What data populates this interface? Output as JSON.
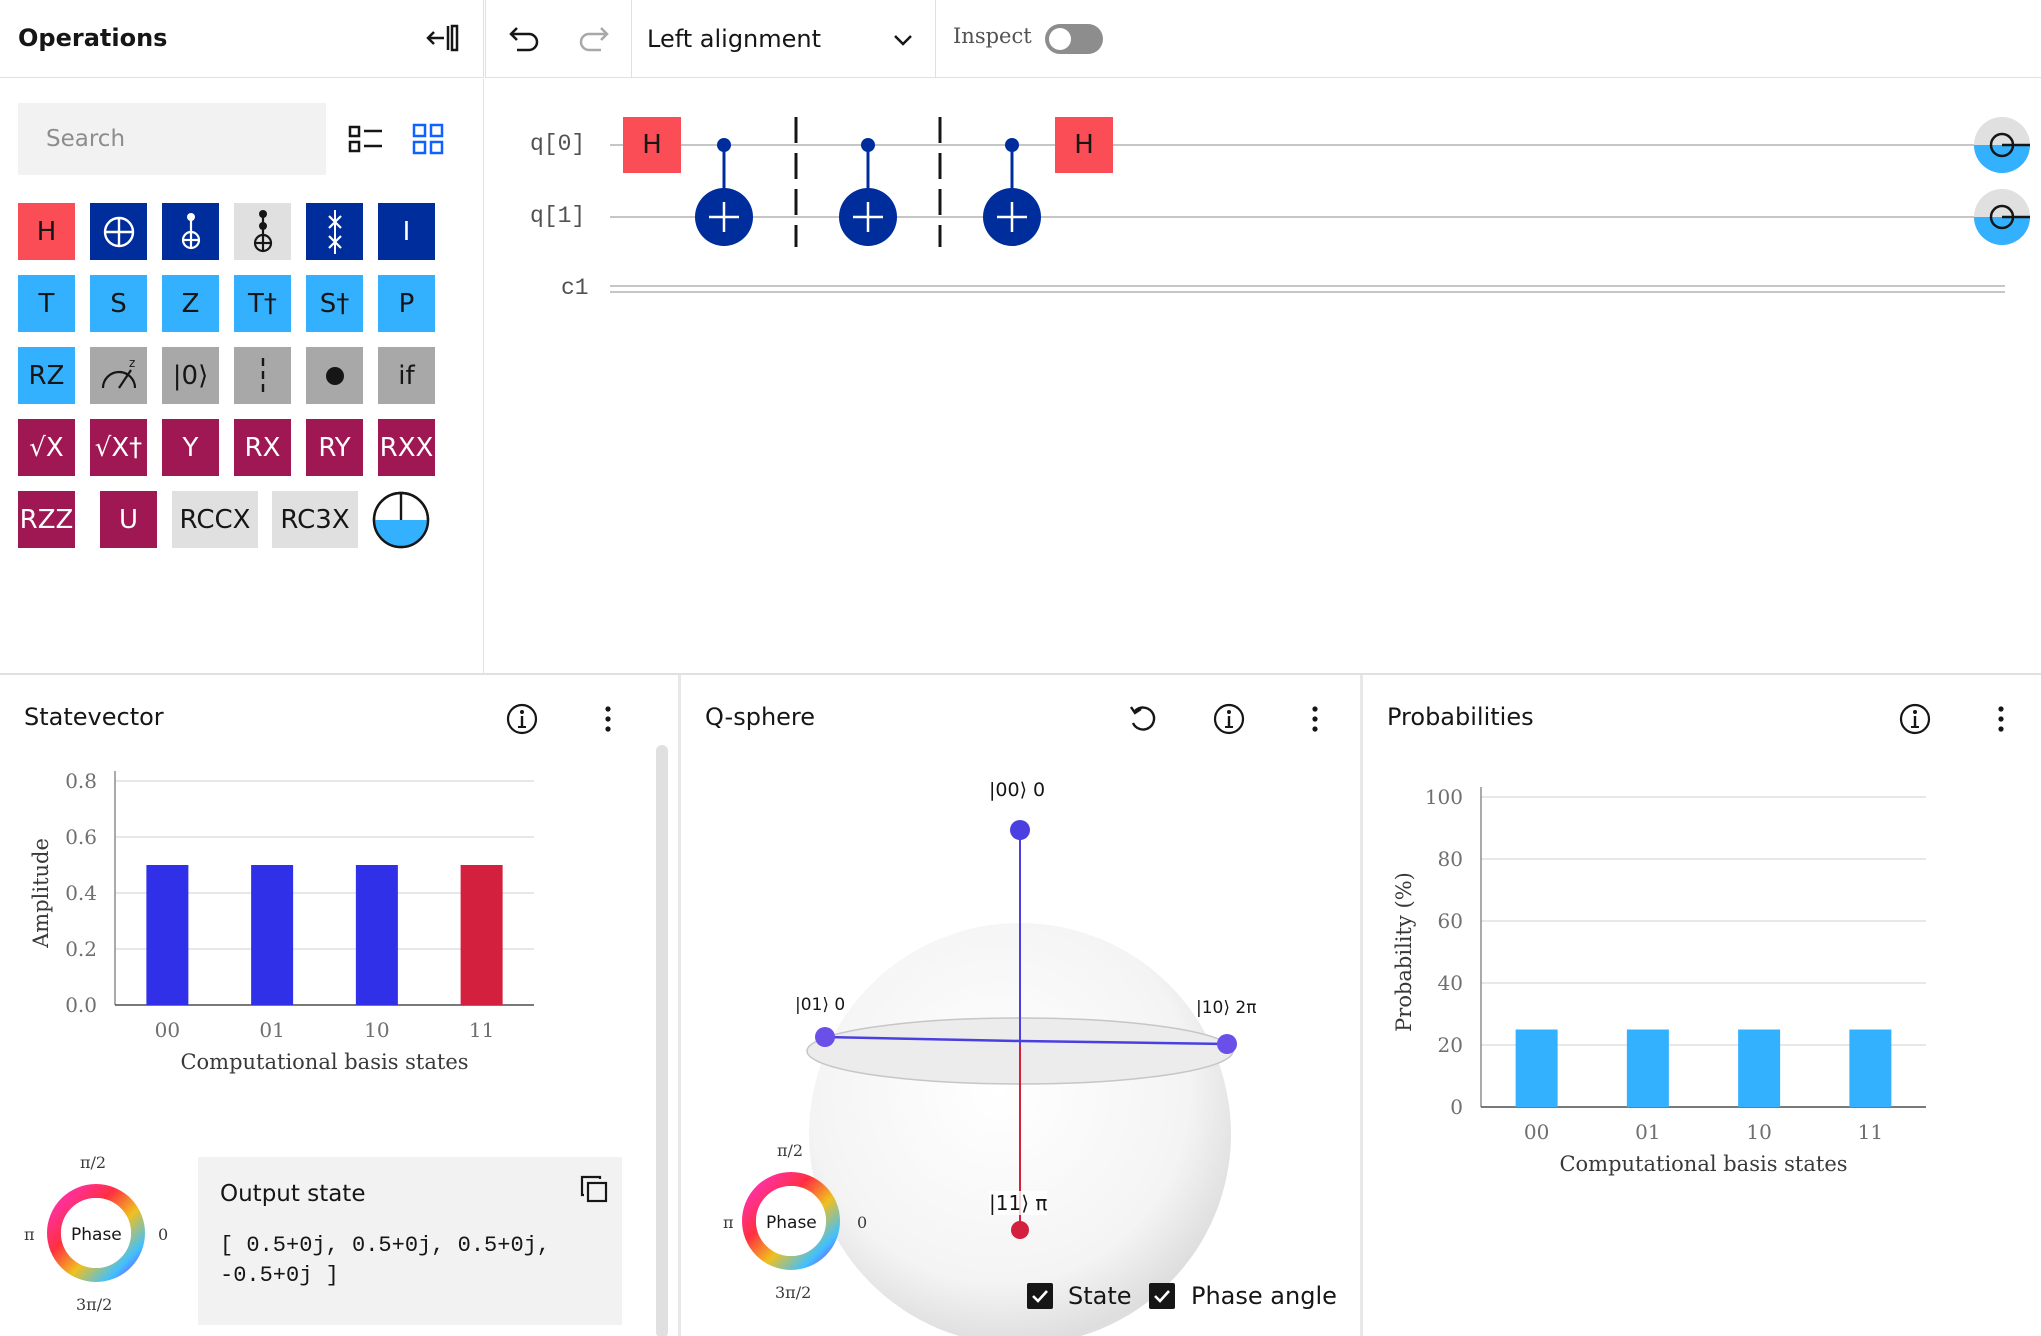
{
  "operations": {
    "title": "Operations",
    "search_placeholder": "Search",
    "gates": [
      {
        "label": "H",
        "bg": "#fa4d56",
        "fg": "#161616"
      },
      {
        "label": "",
        "bg": "#002d9c",
        "fg": "#ffffff",
        "icon": "cnot-target-icon"
      },
      {
        "label": "",
        "bg": "#002d9c",
        "fg": "#ffffff",
        "icon": "controlled-x-icon"
      },
      {
        "label": "",
        "bg": "#e0e0e0",
        "fg": "#161616",
        "icon": "toffoli-icon"
      },
      {
        "label": "",
        "bg": "#002d9c",
        "fg": "#ffffff",
        "icon": "swap-icon"
      },
      {
        "label": "I",
        "bg": "#002d9c",
        "fg": "#ffffff"
      },
      {
        "label": "T",
        "bg": "#33b1ff",
        "fg": "#161616"
      },
      {
        "label": "S",
        "bg": "#33b1ff",
        "fg": "#161616"
      },
      {
        "label": "Z",
        "bg": "#33b1ff",
        "fg": "#161616"
      },
      {
        "label": "T†",
        "bg": "#33b1ff",
        "fg": "#161616"
      },
      {
        "label": "S†",
        "bg": "#33b1ff",
        "fg": "#161616"
      },
      {
        "label": "P",
        "bg": "#33b1ff",
        "fg": "#161616"
      },
      {
        "label": "RZ",
        "bg": "#33b1ff",
        "fg": "#161616"
      },
      {
        "label": "",
        "bg": "#a8a8a8",
        "fg": "#161616",
        "icon": "measure-z-icon"
      },
      {
        "label": "|0⟩",
        "bg": "#a8a8a8",
        "fg": "#161616"
      },
      {
        "label": "",
        "bg": "#a8a8a8",
        "fg": "#161616",
        "icon": "barrier-icon"
      },
      {
        "label": "",
        "bg": "#a8a8a8",
        "fg": "#161616",
        "icon": "control-dot-icon"
      },
      {
        "label": "if",
        "bg": "#a8a8a8",
        "fg": "#161616"
      },
      {
        "label": "√X",
        "bg": "#9f1853",
        "fg": "#ffffff"
      },
      {
        "label": "√X†",
        "bg": "#9f1853",
        "fg": "#ffffff"
      },
      {
        "label": "Y",
        "bg": "#9f1853",
        "fg": "#ffffff"
      },
      {
        "label": "RX",
        "bg": "#9f1853",
        "fg": "#ffffff"
      },
      {
        "label": "RY",
        "bg": "#9f1853",
        "fg": "#ffffff"
      },
      {
        "label": "RXX",
        "bg": "#9f1853",
        "fg": "#ffffff"
      },
      {
        "label": "RZZ",
        "bg": "#9f1853",
        "fg": "#ffffff"
      },
      {
        "label": "U",
        "bg": "#9f1853",
        "fg": "#ffffff"
      },
      {
        "label": "RCCX",
        "bg": "#e0e0e0",
        "fg": "#161616"
      },
      {
        "label": "RC3X",
        "bg": "#e0e0e0",
        "fg": "#161616"
      },
      {
        "label": "",
        "bg": "#ffffff",
        "fg": "#161616",
        "icon": "probability-disk-icon"
      }
    ]
  },
  "toolbar": {
    "alignment": "Left alignment",
    "inspect_label": "Inspect",
    "inspect_on": false
  },
  "circuit": {
    "qubits": [
      "q[0]",
      "q[1]"
    ],
    "classical": "c1",
    "gate_label": "H"
  },
  "statevector": {
    "title": "Statevector",
    "output_title": "Output state",
    "output_text": "[ 0.5+0j, 0.5+0j, 0.5+0j,\n-0.5+0j ]",
    "phase_wheel": {
      "center": "Phase",
      "top": "π/2",
      "right": "0",
      "bottom": "3π/2",
      "left": "π"
    }
  },
  "qsphere": {
    "title": "Q-sphere",
    "state_labels": [
      "|00⟩ 0",
      "|01⟩ 0",
      "|10⟩ 2π",
      "|11⟩ π"
    ],
    "phase_wheel": {
      "center": "Phase",
      "top": "π/2",
      "right": "0",
      "bottom": "3π/2",
      "left": "π"
    },
    "checkbox_state": "State",
    "checkbox_phase": "Phase angle"
  },
  "probabilities": {
    "title": "Probabilities"
  },
  "chart_data": [
    {
      "type": "bar",
      "categories": [
        "00",
        "01",
        "10",
        "11"
      ],
      "values": [
        0.5,
        0.5,
        0.5,
        0.5
      ],
      "colors": [
        "#3030e8",
        "#3030e8",
        "#3030e8",
        "#d4203f"
      ],
      "xlabel": "Computational basis states",
      "ylabel": "Amplitude",
      "ylim": [
        0,
        0.8
      ],
      "yticks": [
        "0.0",
        "0.2",
        "0.4",
        "0.6",
        "0.8"
      ]
    },
    {
      "type": "bar",
      "categories": [
        "00",
        "01",
        "10",
        "11"
      ],
      "values": [
        25,
        25,
        25,
        25
      ],
      "color": "#33b1ff",
      "xlabel": "Computational basis states",
      "ylabel": "Probability (%)",
      "ylim": [
        0,
        100
      ],
      "yticks": [
        "0",
        "20",
        "40",
        "60",
        "80",
        "100"
      ]
    }
  ]
}
